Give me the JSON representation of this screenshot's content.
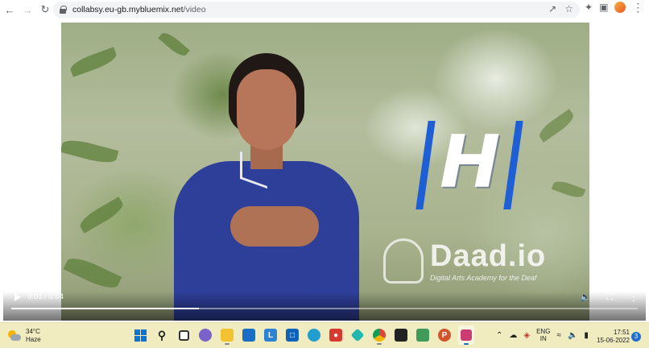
{
  "browser": {
    "url_host": "collabsy.eu-gb.mybluemix.net",
    "url_path": "/video"
  },
  "video": {
    "overlay_letter": "H",
    "watermark_name": "Daad.io",
    "watermark_tagline": "Digital Arts Academy for the Deaf",
    "time_display": "0:01 / 0:04",
    "progress_fraction": 0.3
  },
  "taskbar": {
    "weather_temp": "34°C",
    "weather_desc": "Haze",
    "language_top": "ENG",
    "language_bottom": "IN",
    "clock_time": "17:51",
    "clock_date": "15-06-2022",
    "notification_count": "3",
    "apps": [
      {
        "name": "start-icon"
      },
      {
        "name": "search-icon"
      },
      {
        "name": "task-view-icon"
      },
      {
        "name": "chat-icon"
      },
      {
        "name": "file-explorer-icon"
      },
      {
        "name": "store-icon"
      },
      {
        "name": "l-app-icon"
      },
      {
        "name": "outlook-icon"
      },
      {
        "name": "edge-icon"
      },
      {
        "name": "media-app-icon"
      },
      {
        "name": "cube-app-icon"
      },
      {
        "name": "chrome-icon"
      },
      {
        "name": "terminal-icon"
      },
      {
        "name": "spreadsheet-icon"
      },
      {
        "name": "powerpoint-icon"
      },
      {
        "name": "snipping-tool-icon"
      }
    ]
  },
  "colors": {
    "taskbar_bg": "#f0ecc0",
    "overlay_bar": "#1f5fd6",
    "shirt": "#2e3f9a"
  }
}
